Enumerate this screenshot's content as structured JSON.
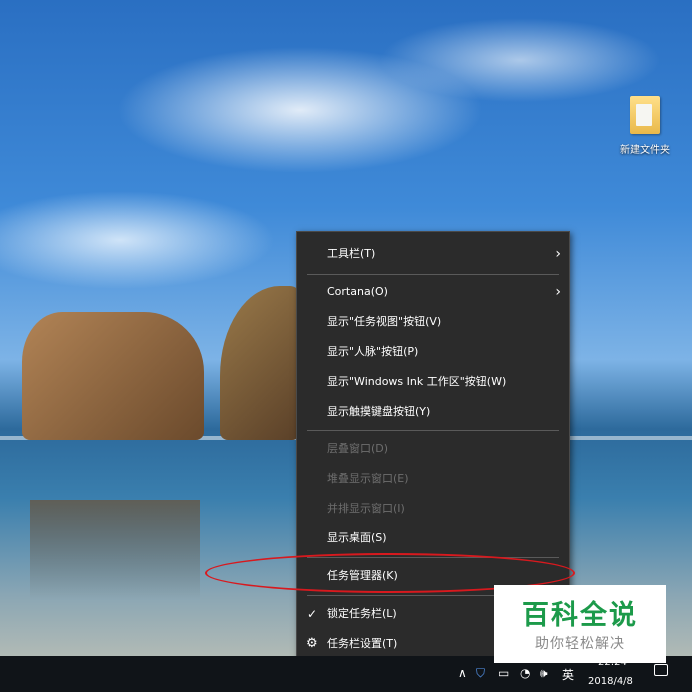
{
  "desktop": {
    "icons": [
      {
        "label": "新建文件夹",
        "icon": "folder-icon"
      }
    ]
  },
  "context_menu": {
    "items": [
      {
        "label": "工具栏(T)",
        "submenu": true
      },
      {
        "label": "Cortana(O)",
        "submenu": true
      },
      {
        "label": "显示\"任务视图\"按钮(V)"
      },
      {
        "label": "显示\"人脉\"按钮(P)"
      },
      {
        "label": "显示\"Windows Ink 工作区\"按钮(W)"
      },
      {
        "label": "显示触摸键盘按钮(Y)"
      },
      {
        "label": "层叠窗口(D)",
        "disabled": true
      },
      {
        "label": "堆叠显示窗口(E)",
        "disabled": true
      },
      {
        "label": "并排显示窗口(I)",
        "disabled": true
      },
      {
        "label": "显示桌面(S)"
      },
      {
        "label": "任务管理器(K)",
        "highlighted": true
      },
      {
        "label": "锁定任务栏(L)",
        "checked": true
      },
      {
        "label": "任务栏设置(T)",
        "icon": "gear-icon"
      }
    ],
    "chevron_glyph": "›",
    "check_glyph": "✓",
    "gear_glyph": "⚙"
  },
  "annotation": {
    "color": "#d8191e"
  },
  "watermark": {
    "title": "百科全说",
    "subtitle": "助你轻松解决",
    "title_color": "#1c9a4a"
  },
  "taskbar": {
    "tray_glyphs": {
      "chevron_up": "∧",
      "shield": "⛉",
      "network": "◔",
      "volume": "🕪"
    },
    "ime_label": "英",
    "clock_time": "22:24",
    "clock_date": "2018/4/8"
  }
}
